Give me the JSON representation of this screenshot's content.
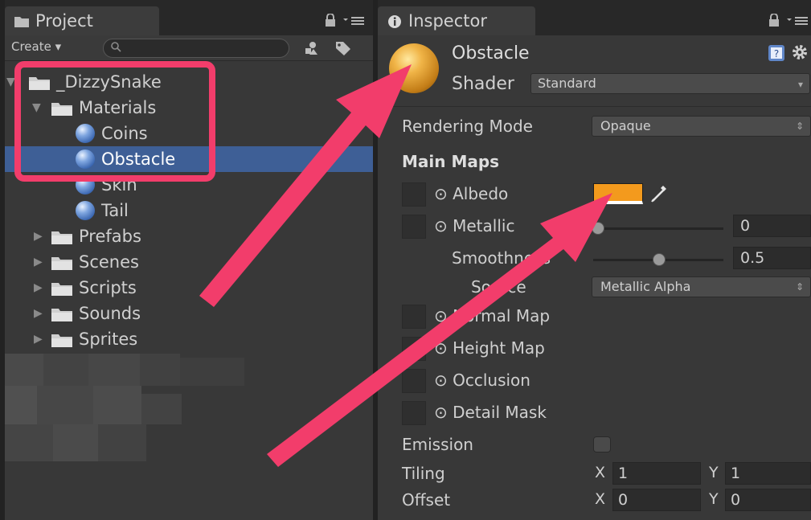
{
  "project": {
    "tab_title": "Project",
    "create_label": "Create ▾",
    "search_placeholder": "",
    "tree": [
      {
        "label": "_DizzySnake",
        "type": "folder",
        "depth": 0,
        "expanded": true
      },
      {
        "label": "Materials",
        "type": "folder",
        "depth": 1,
        "expanded": true
      },
      {
        "label": "Coins",
        "type": "material",
        "depth": 2
      },
      {
        "label": "Obstacle",
        "type": "material",
        "depth": 2,
        "selected": true
      },
      {
        "label": "Skin",
        "type": "material",
        "depth": 2
      },
      {
        "label": "Tail",
        "type": "material",
        "depth": 2
      },
      {
        "label": "Prefabs",
        "type": "folder",
        "depth": 1,
        "expanded": false
      },
      {
        "label": "Scenes",
        "type": "folder",
        "depth": 1,
        "expanded": false
      },
      {
        "label": "Scripts",
        "type": "folder",
        "depth": 1,
        "expanded": false
      },
      {
        "label": "Sounds",
        "type": "folder",
        "depth": 1,
        "expanded": false
      },
      {
        "label": "Sprites",
        "type": "folder",
        "depth": 1,
        "expanded": false
      }
    ]
  },
  "inspector": {
    "tab_title": "Inspector",
    "material_name": "Obstacle",
    "shader_label": "Shader",
    "shader_value": "Standard",
    "rendering_mode_label": "Rendering Mode",
    "rendering_mode_value": "Opaque",
    "main_maps_label": "Main Maps",
    "albedo_label": "⊙ Albedo",
    "albedo_color": "#f39a1d",
    "metallic_label": "⊙ Metallic",
    "metallic_value": "0",
    "smoothness_label": "Smoothness",
    "smoothness_value": "0.5",
    "source_label": "Source",
    "source_value": "Metallic Alpha",
    "normal_map_label": "⊙ Normal Map",
    "height_map_label": "⊙ Height Map",
    "occlusion_label": "⊙ Occlusion",
    "detail_mask_label": "⊙ Detail Mask",
    "emission_label": "Emission",
    "tiling_label": "Tiling",
    "tiling_x": "1",
    "tiling_y": "1",
    "offset_label": "Offset",
    "offset_x": "0",
    "offset_y": "0",
    "axis_x": "X",
    "axis_y": "Y"
  },
  "colors": {
    "selection": "#3e5f96",
    "annotation": "#f23d6b",
    "albedo": "#f39a1d"
  },
  "icons": [
    "folder-icon",
    "lock-icon",
    "menu-icon",
    "search-icon",
    "filter-icon",
    "label-icon",
    "info-icon",
    "help-icon",
    "gear-icon",
    "eyedropper-icon",
    "material-sphere-icon"
  ]
}
